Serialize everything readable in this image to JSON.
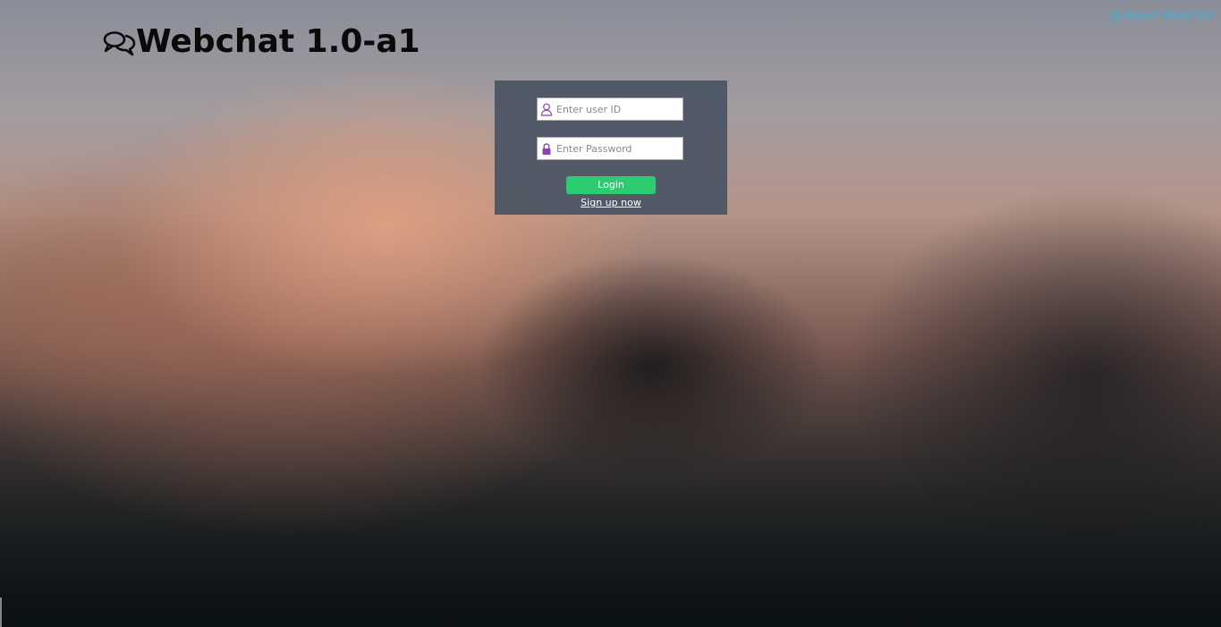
{
  "header": {
    "title": "Webchat 1.0-a1",
    "title_icon": "chat-bubbles-icon",
    "about_label": "About WebChat",
    "about_icon": "help-circle-icon",
    "accent_color": "#36b5d9"
  },
  "login": {
    "user_id_placeholder": "Enter user ID",
    "user_id_value": "",
    "user_icon": "user-icon",
    "password_placeholder": "Enter Password",
    "password_value": "",
    "password_icon": "lock-icon",
    "login_label": "Login",
    "login_color": "#2ecc71",
    "signup_label": "Sign up now",
    "icon_color": "#8e44ad"
  }
}
